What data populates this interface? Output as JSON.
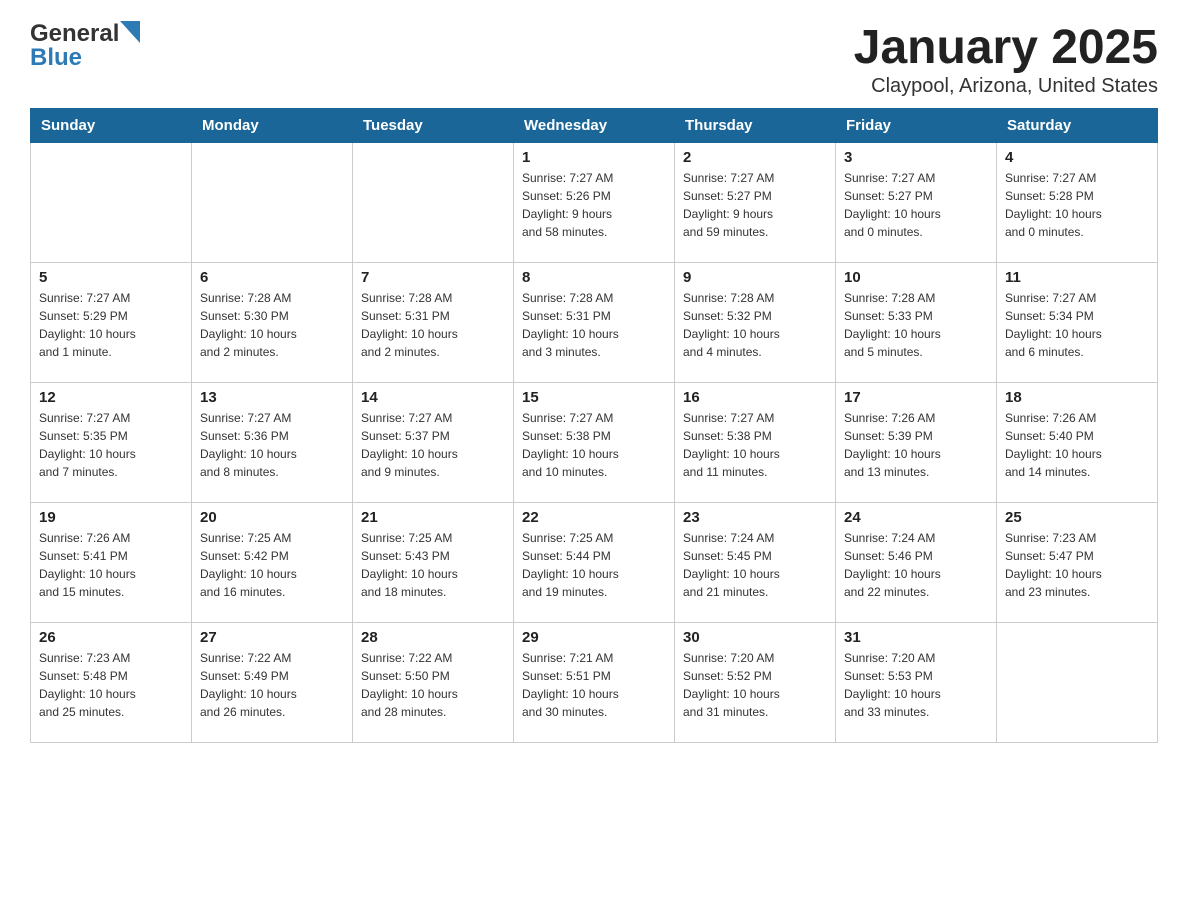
{
  "header": {
    "logo_general": "General",
    "logo_blue": "Blue",
    "title": "January 2025",
    "subtitle": "Claypool, Arizona, United States"
  },
  "calendar": {
    "days_of_week": [
      "Sunday",
      "Monday",
      "Tuesday",
      "Wednesday",
      "Thursday",
      "Friday",
      "Saturday"
    ],
    "weeks": [
      [
        {
          "day": "",
          "info": ""
        },
        {
          "day": "",
          "info": ""
        },
        {
          "day": "",
          "info": ""
        },
        {
          "day": "1",
          "info": "Sunrise: 7:27 AM\nSunset: 5:26 PM\nDaylight: 9 hours\nand 58 minutes."
        },
        {
          "day": "2",
          "info": "Sunrise: 7:27 AM\nSunset: 5:27 PM\nDaylight: 9 hours\nand 59 minutes."
        },
        {
          "day": "3",
          "info": "Sunrise: 7:27 AM\nSunset: 5:27 PM\nDaylight: 10 hours\nand 0 minutes."
        },
        {
          "day": "4",
          "info": "Sunrise: 7:27 AM\nSunset: 5:28 PM\nDaylight: 10 hours\nand 0 minutes."
        }
      ],
      [
        {
          "day": "5",
          "info": "Sunrise: 7:27 AM\nSunset: 5:29 PM\nDaylight: 10 hours\nand 1 minute."
        },
        {
          "day": "6",
          "info": "Sunrise: 7:28 AM\nSunset: 5:30 PM\nDaylight: 10 hours\nand 2 minutes."
        },
        {
          "day": "7",
          "info": "Sunrise: 7:28 AM\nSunset: 5:31 PM\nDaylight: 10 hours\nand 2 minutes."
        },
        {
          "day": "8",
          "info": "Sunrise: 7:28 AM\nSunset: 5:31 PM\nDaylight: 10 hours\nand 3 minutes."
        },
        {
          "day": "9",
          "info": "Sunrise: 7:28 AM\nSunset: 5:32 PM\nDaylight: 10 hours\nand 4 minutes."
        },
        {
          "day": "10",
          "info": "Sunrise: 7:28 AM\nSunset: 5:33 PM\nDaylight: 10 hours\nand 5 minutes."
        },
        {
          "day": "11",
          "info": "Sunrise: 7:27 AM\nSunset: 5:34 PM\nDaylight: 10 hours\nand 6 minutes."
        }
      ],
      [
        {
          "day": "12",
          "info": "Sunrise: 7:27 AM\nSunset: 5:35 PM\nDaylight: 10 hours\nand 7 minutes."
        },
        {
          "day": "13",
          "info": "Sunrise: 7:27 AM\nSunset: 5:36 PM\nDaylight: 10 hours\nand 8 minutes."
        },
        {
          "day": "14",
          "info": "Sunrise: 7:27 AM\nSunset: 5:37 PM\nDaylight: 10 hours\nand 9 minutes."
        },
        {
          "day": "15",
          "info": "Sunrise: 7:27 AM\nSunset: 5:38 PM\nDaylight: 10 hours\nand 10 minutes."
        },
        {
          "day": "16",
          "info": "Sunrise: 7:27 AM\nSunset: 5:38 PM\nDaylight: 10 hours\nand 11 minutes."
        },
        {
          "day": "17",
          "info": "Sunrise: 7:26 AM\nSunset: 5:39 PM\nDaylight: 10 hours\nand 13 minutes."
        },
        {
          "day": "18",
          "info": "Sunrise: 7:26 AM\nSunset: 5:40 PM\nDaylight: 10 hours\nand 14 minutes."
        }
      ],
      [
        {
          "day": "19",
          "info": "Sunrise: 7:26 AM\nSunset: 5:41 PM\nDaylight: 10 hours\nand 15 minutes."
        },
        {
          "day": "20",
          "info": "Sunrise: 7:25 AM\nSunset: 5:42 PM\nDaylight: 10 hours\nand 16 minutes."
        },
        {
          "day": "21",
          "info": "Sunrise: 7:25 AM\nSunset: 5:43 PM\nDaylight: 10 hours\nand 18 minutes."
        },
        {
          "day": "22",
          "info": "Sunrise: 7:25 AM\nSunset: 5:44 PM\nDaylight: 10 hours\nand 19 minutes."
        },
        {
          "day": "23",
          "info": "Sunrise: 7:24 AM\nSunset: 5:45 PM\nDaylight: 10 hours\nand 21 minutes."
        },
        {
          "day": "24",
          "info": "Sunrise: 7:24 AM\nSunset: 5:46 PM\nDaylight: 10 hours\nand 22 minutes."
        },
        {
          "day": "25",
          "info": "Sunrise: 7:23 AM\nSunset: 5:47 PM\nDaylight: 10 hours\nand 23 minutes."
        }
      ],
      [
        {
          "day": "26",
          "info": "Sunrise: 7:23 AM\nSunset: 5:48 PM\nDaylight: 10 hours\nand 25 minutes."
        },
        {
          "day": "27",
          "info": "Sunrise: 7:22 AM\nSunset: 5:49 PM\nDaylight: 10 hours\nand 26 minutes."
        },
        {
          "day": "28",
          "info": "Sunrise: 7:22 AM\nSunset: 5:50 PM\nDaylight: 10 hours\nand 28 minutes."
        },
        {
          "day": "29",
          "info": "Sunrise: 7:21 AM\nSunset: 5:51 PM\nDaylight: 10 hours\nand 30 minutes."
        },
        {
          "day": "30",
          "info": "Sunrise: 7:20 AM\nSunset: 5:52 PM\nDaylight: 10 hours\nand 31 minutes."
        },
        {
          "day": "31",
          "info": "Sunrise: 7:20 AM\nSunset: 5:53 PM\nDaylight: 10 hours\nand 33 minutes."
        },
        {
          "day": "",
          "info": ""
        }
      ]
    ]
  }
}
